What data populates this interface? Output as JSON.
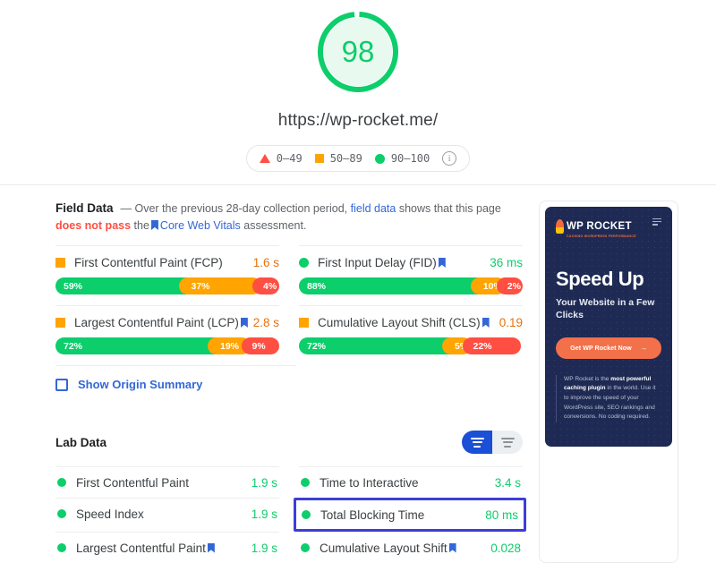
{
  "score": {
    "value": "98",
    "ring_color": "#0cce6b",
    "fill_color": "#e8f9f0"
  },
  "page_url": "https://wp-rocket.me/",
  "legend": {
    "items": [
      {
        "icon": "triangle-red-icon",
        "label": "0–49",
        "color": "#ff4e42"
      },
      {
        "icon": "square-orange-icon",
        "label": "50–89",
        "color": "#ffa400"
      },
      {
        "icon": "circle-green-icon",
        "label": "90–100",
        "color": "#0cce6b"
      }
    ],
    "info_icon": "i"
  },
  "field_data": {
    "title": "Field Data",
    "desc_dash": "—",
    "desc_1": "Over the previous 28-day collection period,",
    "link_1": "field data",
    "desc_2": "shows that this page",
    "fail_text": "does not pass",
    "desc_3": "the",
    "link_2": "Core Web Vitals",
    "desc_4": "assessment.",
    "metrics": [
      {
        "icon": "square-orange-icon",
        "status": "orange",
        "name": "First Contentful Paint (FCP)",
        "bookmark": false,
        "value": "1.6 s",
        "value_color": "orange",
        "distribution": [
          {
            "pct": 59,
            "label": "59%",
            "band": "good"
          },
          {
            "pct": 37,
            "label": "37%",
            "band": "needs-improvement"
          },
          {
            "pct": 4,
            "label": "4%",
            "band": "poor"
          }
        ]
      },
      {
        "icon": "circle-green-icon",
        "status": "green",
        "name": "First Input Delay (FID)",
        "bookmark": true,
        "value": "36 ms",
        "value_color": "green",
        "distribution": [
          {
            "pct": 88,
            "label": "88%",
            "band": "good"
          },
          {
            "pct": 10,
            "label": "10%",
            "band": "needs-improvement"
          },
          {
            "pct": 2,
            "label": "2%",
            "band": "poor"
          }
        ]
      },
      {
        "icon": "square-orange-icon",
        "status": "orange",
        "name": "Largest Contentful Paint (LCP)",
        "bookmark": true,
        "value": "2.8 s",
        "value_color": "orange",
        "distribution": [
          {
            "pct": 72,
            "label": "72%",
            "band": "good"
          },
          {
            "pct": 19,
            "label": "19%",
            "band": "needs-improvement"
          },
          {
            "pct": 9,
            "label": "9%",
            "band": "poor"
          }
        ]
      },
      {
        "icon": "square-orange-icon",
        "status": "orange",
        "name": "Cumulative Layout Shift (CLS)",
        "bookmark": true,
        "value": "0.19",
        "value_color": "orange",
        "distribution": [
          {
            "pct": 72,
            "label": "72%",
            "band": "good"
          },
          {
            "pct": 5,
            "label": "5%",
            "band": "needs-improvement"
          },
          {
            "pct": 22,
            "label": "22%",
            "band": "poor"
          }
        ]
      }
    ],
    "origin_summary_label": "Show Origin Summary",
    "origin_summary_checked": false
  },
  "lab_data": {
    "title": "Lab Data",
    "view_toggle": {
      "grid_view_icon": "grid-view-icon",
      "list_view_icon": "list-view-icon",
      "selected": "grid"
    },
    "metrics": [
      {
        "name": "First Contentful Paint",
        "value": "1.9 s",
        "bookmark": false,
        "highlighted": false
      },
      {
        "name": "Time to Interactive",
        "value": "3.4 s",
        "bookmark": false,
        "highlighted": false
      },
      {
        "name": "Speed Index",
        "value": "1.9 s",
        "bookmark": false,
        "highlighted": false
      },
      {
        "name": "Total Blocking Time",
        "value": "80 ms",
        "bookmark": false,
        "highlighted": true
      },
      {
        "name": "Largest Contentful Paint",
        "value": "1.9 s",
        "bookmark": true,
        "highlighted": false
      },
      {
        "name": "Cumulative Layout Shift",
        "value": "0.028",
        "bookmark": true,
        "highlighted": false
      }
    ],
    "highlight_color": "#3d3ddb"
  },
  "ad": {
    "brand": "ROCKET",
    "brand_prefix": "WP",
    "tagline": "CACHING WORDPRESS PERFORMANCE",
    "heading": "Speed Up",
    "subheading": "Your Website in a Few Clicks",
    "cta_label": "Get WP Rocket Now",
    "cta_arrow": "→",
    "body_1": "WP Rocket is the ",
    "body_bold": "most powerful caching plugin",
    "body_2": " in the world. Use it to improve the speed of your WordPress site, SEO rankings and conversions. No coding required.",
    "bg_color": "#1e2a53",
    "accent_color": "#f2704a"
  }
}
